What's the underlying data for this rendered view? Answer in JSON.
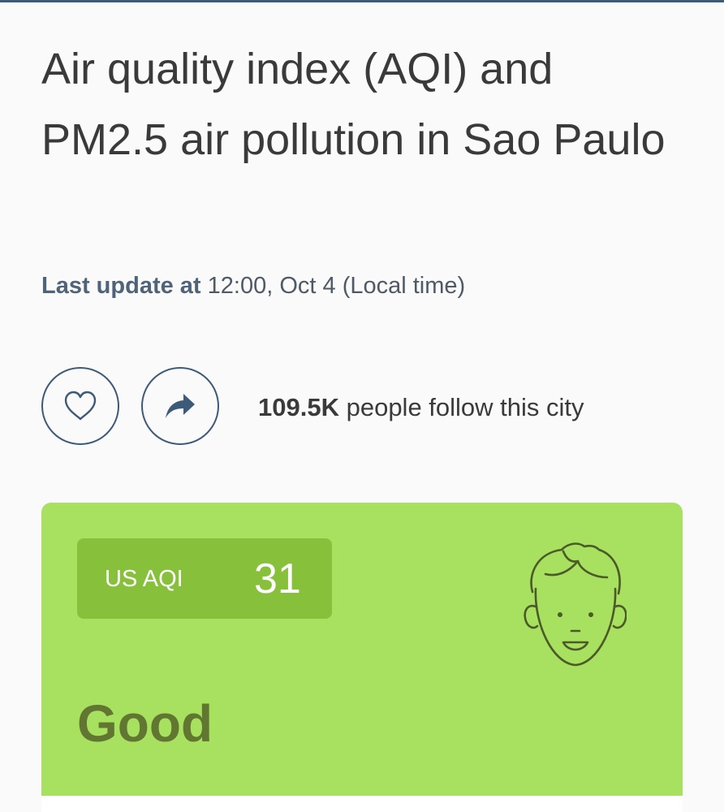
{
  "page": {
    "title": "Air quality index (AQI) and PM2.5 air pollution in Sao Paulo"
  },
  "update": {
    "label": "Last update at",
    "value": "12:00, Oct 4 (Local time)"
  },
  "actions": {
    "follow_icon": "heart-icon",
    "share_icon": "share-arrow-icon"
  },
  "followers": {
    "count": "109.5K",
    "text": "people follow this city"
  },
  "aqi": {
    "label": "US AQI",
    "value": "31",
    "status": "Good",
    "icon": "smiling-face-icon",
    "colors": {
      "card": "#a8e05f",
      "pill": "#87c13c",
      "status_text": "#607631"
    }
  },
  "colors": {
    "accent": "#3d5a78"
  }
}
